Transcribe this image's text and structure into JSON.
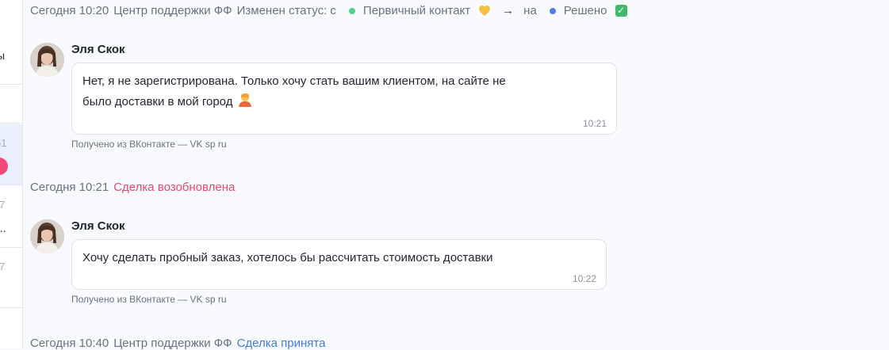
{
  "left_panel": {
    "items": [
      {
        "text": "ы"
      },
      {
        "time": "51"
      },
      {
        "time": "7",
        "text": "..."
      },
      {
        "time": "7"
      }
    ]
  },
  "events": [
    {
      "time": "Сегодня 10:20",
      "author": "Центр поддержки ФФ",
      "action": "Изменен статус: с",
      "from_status": "Первичный контакт",
      "arrow": "→",
      "to_word": "на",
      "to_status": "Решено"
    },
    {
      "time": "Сегодня 10:21",
      "action": "Сделка возобновлена"
    },
    {
      "time": "Сегодня 10:40",
      "author": "Центр поддержки ФФ",
      "action": "Сделка принята"
    }
  ],
  "messages": [
    {
      "name": "Эля Скок",
      "text_line1": "Нет, я не зарегистрирована. Только хочу стать вашим клиентом, на сайте не",
      "text_line2": "было доставки в мой город",
      "time": "10:21",
      "source": "Получено из ВКонтакте — VK sp ru"
    },
    {
      "name": "Эля Скок",
      "text_line1": "Хочу сделать пробный заказ, хотелось бы рассчитать стоимость доставки",
      "time": "10:22",
      "source": "Получено из ВКонтакте — VK sp ru"
    }
  ],
  "colors": {
    "accent_pink": "#e64b6e",
    "accent_blue": "#3d7fe0",
    "status_green": "#4fd18b",
    "status_blue": "#4d7ee8"
  }
}
